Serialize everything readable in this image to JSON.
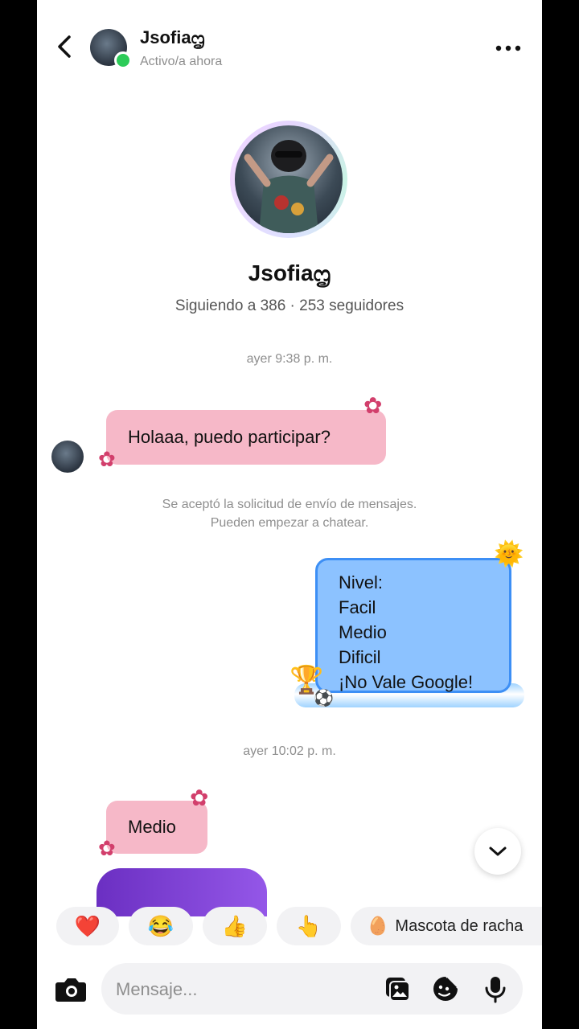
{
  "header": {
    "name": "Jsofiaᦗ",
    "status": "Activo/a ahora"
  },
  "profile": {
    "name": "Jsofiaᦗ",
    "stats": "Siguiendo a 386 · 253 seguidores"
  },
  "messages": {
    "timestamp_1": "ayer 9:38 p. m.",
    "msg_1": "Holaaa, puedo participar?",
    "system_line_1": "Se aceptó la solicitud de envío de mensajes.",
    "system_line_2": "Pueden empezar a chatear.",
    "blue_lines": [
      "Nivel:",
      "Facil",
      "Medio",
      "Dificil",
      "¡No Vale Google!"
    ],
    "timestamp_2": "ayer 10:02 p. m.",
    "msg_2": "Medio"
  },
  "quick_replies": {
    "heart": "❤️",
    "laugh": "😂",
    "thumbs": "👍",
    "point": "👆",
    "pet_icon": "🥚",
    "pet_label": "Mascota de racha"
  },
  "composer": {
    "placeholder": "Mensaje..."
  },
  "icons": {
    "back": "chevron-left-icon",
    "more": "more-horizontal-icon",
    "camera": "camera-icon",
    "gallery": "gallery-icon",
    "sticker": "sticker-icon",
    "mic": "microphone-icon",
    "scroll": "chevron-down-icon"
  },
  "colors": {
    "pink_bubble": "#f6b8c8",
    "blue_bubble": "#8cc2ff",
    "online": "#2ccb58"
  }
}
